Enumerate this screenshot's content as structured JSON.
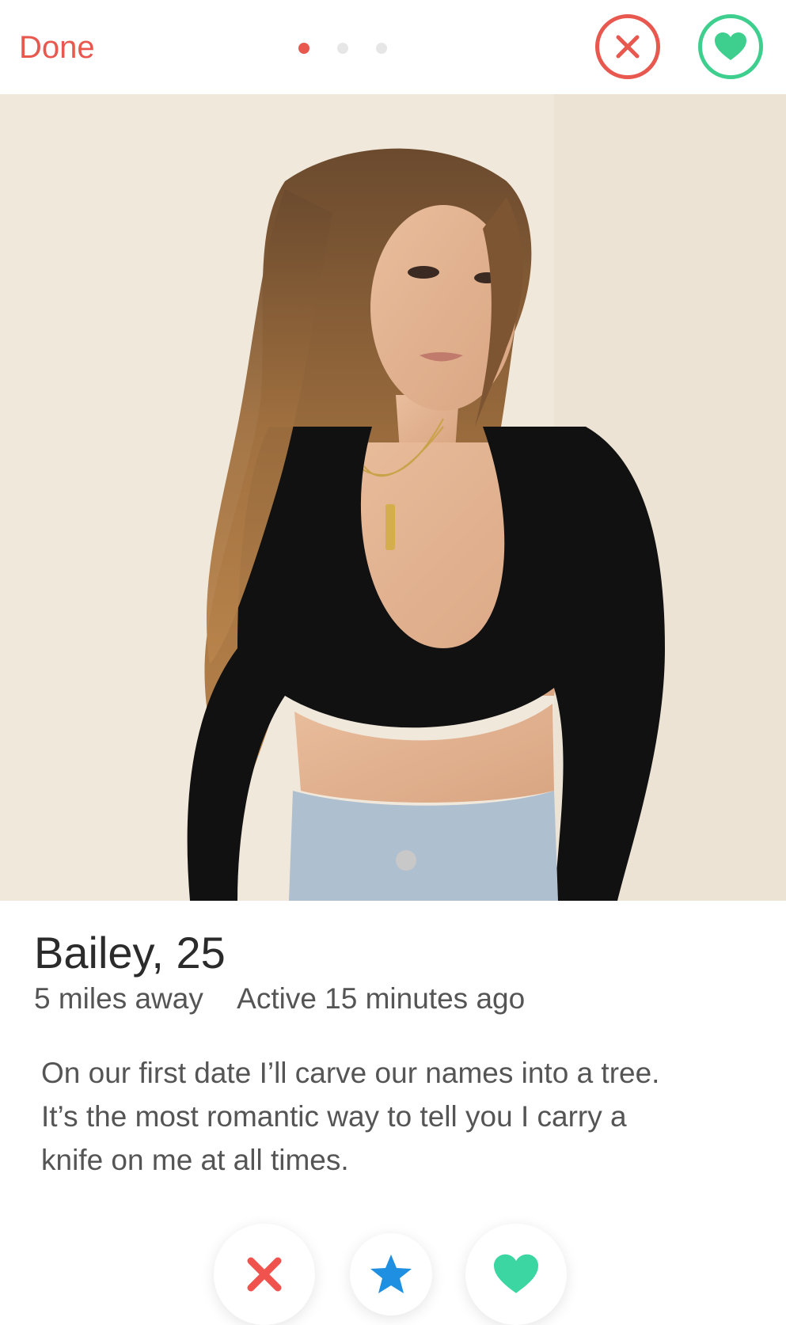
{
  "topbar": {
    "done_label": "Done",
    "photo_dots": {
      "count": 3,
      "active_index": 0
    },
    "close_icon": "close-icon",
    "like_icon": "heart-icon"
  },
  "profile": {
    "name_age": "Bailey, 25",
    "distance": "5 miles away",
    "activity": "Active 15 minutes ago",
    "bio_lines": [
      "On our first date I’ll carve our names into a tree.",
      "It’s the most romantic way to tell you I carry a",
      "knife on me at all times."
    ]
  },
  "actions": {
    "nope_icon": "x-icon",
    "super_like_icon": "star-icon",
    "like_icon": "heart-icon"
  },
  "colors": {
    "accent_red": "#e8584f",
    "accent_green": "#3ecf8e",
    "star_blue": "#1e8fe1",
    "heart_green": "#3cd6a3"
  }
}
